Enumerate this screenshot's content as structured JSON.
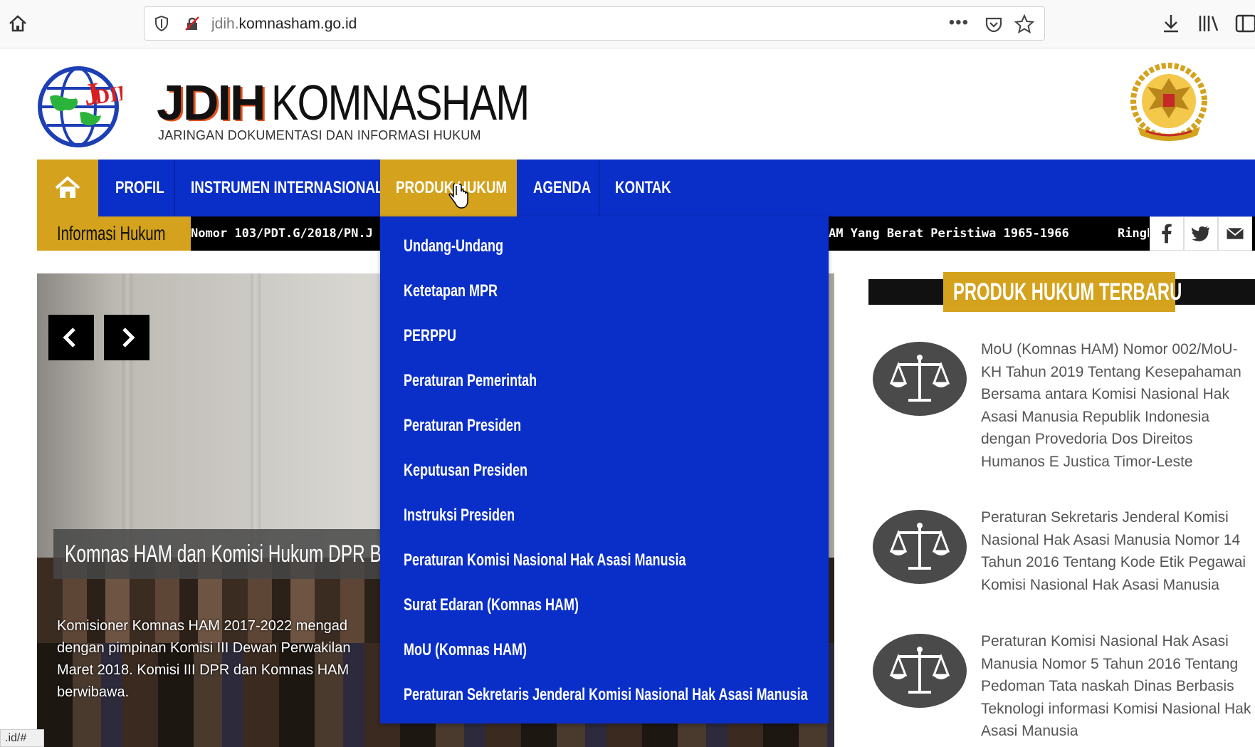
{
  "browser": {
    "url_dim": "jdih.",
    "url_main": "komnasham.go.id",
    "more_label": "•••"
  },
  "header": {
    "title_a": "JDIH",
    "title_b": "KOMNASHAM",
    "subtitle": "JARINGAN DOKUMENTASI DAN INFORMASI HUKUM",
    "accent": "#d4a21c",
    "nav_blue": "#0a2fc9"
  },
  "nav": {
    "items": [
      {
        "label": "PROFIL"
      },
      {
        "label": "INSTRUMEN INTERNASIONAL"
      },
      {
        "label": "PRODUK HUKUM"
      },
      {
        "label": "AGENDA"
      },
      {
        "label": "KONTAK"
      }
    ]
  },
  "ticker": {
    "label": "Informasi Hukum",
    "text_left": "Nomor 103/PDT.G/2018/PN.J",
    "text_mid": "AM Yang Berat Peristiwa 1965-1966",
    "text_right": "Ringk"
  },
  "dropdown": {
    "items": [
      {
        "label": "Undang-Undang"
      },
      {
        "label": "Ketetapan MPR"
      },
      {
        "label": "PERPPU"
      },
      {
        "label": "Peraturan Pemerintah"
      },
      {
        "label": "Peraturan Presiden"
      },
      {
        "label": "Keputusan Presiden"
      },
      {
        "label": "Instruksi Presiden"
      },
      {
        "label": "Peraturan Komisi Nasional Hak Asasi Manusia"
      },
      {
        "label": "Surat Edaran (Komnas HAM)"
      },
      {
        "label": "MoU (Komnas HAM)"
      },
      {
        "label": "Peraturan Sekretaris Jenderal Komisi Nasional Hak Asasi Manusia"
      }
    ]
  },
  "slider": {
    "caption": "Komnas HAM dan Komisi Hukum DPR Ba",
    "description": "Komisioner Komnas HAM 2017-2022 mengad dengan pimpinan Komisi III Dewan Perwakilan Maret 2018. Komisi III DPR dan Komnas HAM berwibawa."
  },
  "sidebar": {
    "heading": "PRODUK HUKUM TERBARU",
    "items": [
      {
        "text": "MoU (Komnas HAM) Nomor 002/MoU-KH Tahun 2019 Tentang Kesepahaman Bersama antara Komisi Nasional Hak Asasi Manusia Republik Indonesia dengan Provedoria Dos Direitos Humanos E Justica Timor-Leste"
      },
      {
        "text": "Peraturan Sekretaris Jenderal Komisi Nasional Hak Asasi Manusia Nomor 14 Tahun 2016 Tentang Kode Etik Pegawai Komisi Nasional Hak Asasi Manusia"
      },
      {
        "text": "Peraturan Komisi Nasional Hak Asasi Manusia Nomor 5 Tahun 2016 Tentang Pedoman Tata naskah Dinas Berbasis Teknologi informasi Komisi Nasional Hak Asasi Manusia"
      }
    ]
  },
  "status_bar": {
    "text": ".id/#"
  }
}
